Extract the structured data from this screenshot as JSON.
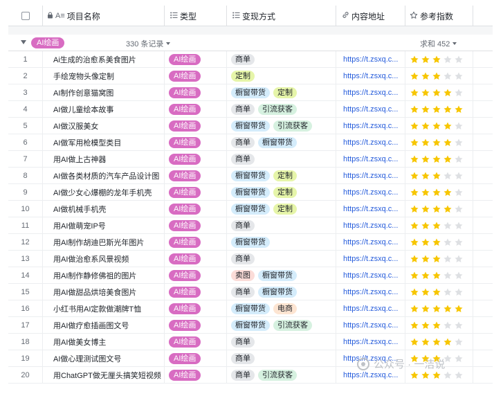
{
  "header": {
    "columns": [
      {
        "key": "checkbox",
        "label": ""
      },
      {
        "key": "name",
        "label": "项目名称",
        "icon": "lock-text-icon"
      },
      {
        "key": "type",
        "label": "类型",
        "icon": "list-icon"
      },
      {
        "key": "way",
        "label": "变现方式",
        "icon": "list-icon"
      },
      {
        "key": "url",
        "label": "内容地址",
        "icon": "link-icon"
      },
      {
        "key": "stars",
        "label": "参考指数",
        "icon": "star-outline-icon"
      }
    ]
  },
  "group": {
    "label": "AI绘画",
    "count_label": "330 条记录",
    "sum_label": "求和 452"
  },
  "colors": {
    "type_tag": "#d86cc2",
    "star_on": "#f7c600",
    "star_off": "#dee0e3",
    "tag_商单": "#e5e7ea",
    "tag_橱窗带货": "#d4ecfb",
    "tag_定制": "#e6f5a9",
    "tag_引流获客": "#d6f1e0",
    "tag_卖图": "#fbdcd8",
    "tag_电商": "#fde5d2"
  },
  "rows": [
    {
      "idx": "1",
      "name": "Ai生成的治愈系美食图片",
      "type": "AI绘画",
      "ways": [
        "商单"
      ],
      "url": "https://t.zsxq.c...",
      "stars": 3
    },
    {
      "idx": "2",
      "name": "手绘宠物头像定制",
      "type": "AI绘画",
      "ways": [
        "定制"
      ],
      "url": "https://t.zsxq.c...",
      "stars": 3
    },
    {
      "idx": "3",
      "name": "AI制作创意猫窝图",
      "type": "AI绘画",
      "ways": [
        "橱窗带货",
        "定制"
      ],
      "url": "https://t.zsxq.c...",
      "stars": 4
    },
    {
      "idx": "4",
      "name": "AI做儿童绘本故事",
      "type": "AI绘画",
      "ways": [
        "商单",
        "引流获客"
      ],
      "url": "https://t.zsxq.c...",
      "stars": 5
    },
    {
      "idx": "5",
      "name": "AI做汉服美女",
      "type": "AI绘画",
      "ways": [
        "橱窗带货",
        "引流获客"
      ],
      "url": "https://t.zsxq.c...",
      "stars": 4
    },
    {
      "idx": "6",
      "name": "AI做军用枪模型类目",
      "type": "AI绘画",
      "ways": [
        "商单",
        "橱窗带货"
      ],
      "url": "https://t.zsxq.c...",
      "stars": 4
    },
    {
      "idx": "7",
      "name": "用AI做上古神器",
      "type": "AI绘画",
      "ways": [
        "商单"
      ],
      "url": "https://t.zsxq.c...",
      "stars": 4
    },
    {
      "idx": "8",
      "name": "AI做各类材质的汽车产品设计图",
      "type": "AI绘画",
      "ways": [
        "橱窗带货",
        "定制"
      ],
      "url": "https://t.zsxq.c...",
      "stars": 3
    },
    {
      "idx": "9",
      "name": "AI做少女心爆棚的龙年手机壳",
      "type": "AI绘画",
      "ways": [
        "橱窗带货",
        "定制"
      ],
      "url": "https://t.zsxq.c...",
      "stars": 4
    },
    {
      "idx": "10",
      "name": "AI做机械手机壳",
      "type": "AI绘画",
      "ways": [
        "橱窗带货",
        "定制"
      ],
      "url": "https://t.zsxq.c...",
      "stars": 4
    },
    {
      "idx": "11",
      "name": "用AI做萌宠IP号",
      "type": "AI绘画",
      "ways": [
        "商单"
      ],
      "url": "https://t.zsxq.c...",
      "stars": 3
    },
    {
      "idx": "12",
      "name": "用AI制作胡迪巴斯光年图片",
      "type": "AI绘画",
      "ways": [
        "橱窗带货"
      ],
      "url": "https://t.zsxq.c...",
      "stars": 3
    },
    {
      "idx": "13",
      "name": "用AI做治愈系风景视频",
      "type": "AI绘画",
      "ways": [
        "商单"
      ],
      "url": "https://t.zsxq.c...",
      "stars": 3
    },
    {
      "idx": "14",
      "name": "用AI制作静修佛祖的图片",
      "type": "AI绘画",
      "ways": [
        "卖图",
        "橱窗带货"
      ],
      "url": "https://t.zsxq.c...",
      "stars": 3
    },
    {
      "idx": "15",
      "name": "用AI做甜品烘培美食图片",
      "type": "AI绘画",
      "ways": [
        "商单",
        "橱窗带货"
      ],
      "url": "https://t.zsxq.c...",
      "stars": 3
    },
    {
      "idx": "16",
      "name": "小红书用AI定款做潮牌T恤",
      "type": "AI绘画",
      "ways": [
        "橱窗带货",
        "电商"
      ],
      "url": "https://t.zsxq.c...",
      "stars": 5
    },
    {
      "idx": "17",
      "name": "用AI做疗愈插画图文号",
      "type": "AI绘画",
      "ways": [
        "橱窗带货",
        "引流获客"
      ],
      "url": "https://t.zsxq.c...",
      "stars": 3
    },
    {
      "idx": "18",
      "name": "用AI做美女博主",
      "type": "AI绘画",
      "ways": [
        "商单"
      ],
      "url": "https://t.zsxq.c...",
      "stars": 4
    },
    {
      "idx": "19",
      "name": "AI做心理测试图文号",
      "type": "AI绘画",
      "ways": [
        "商单"
      ],
      "url": "https://t.zsxq.c...",
      "stars": 3
    },
    {
      "idx": "20",
      "name": "用ChatGPT做无厘头搞笑短视频",
      "type": "AI绘画",
      "ways": [
        "商单",
        "引流获客"
      ],
      "url": "https://t.zsxq.c...",
      "stars": 3
    }
  ],
  "watermark": {
    "text": "公众号 · 一洁说"
  }
}
